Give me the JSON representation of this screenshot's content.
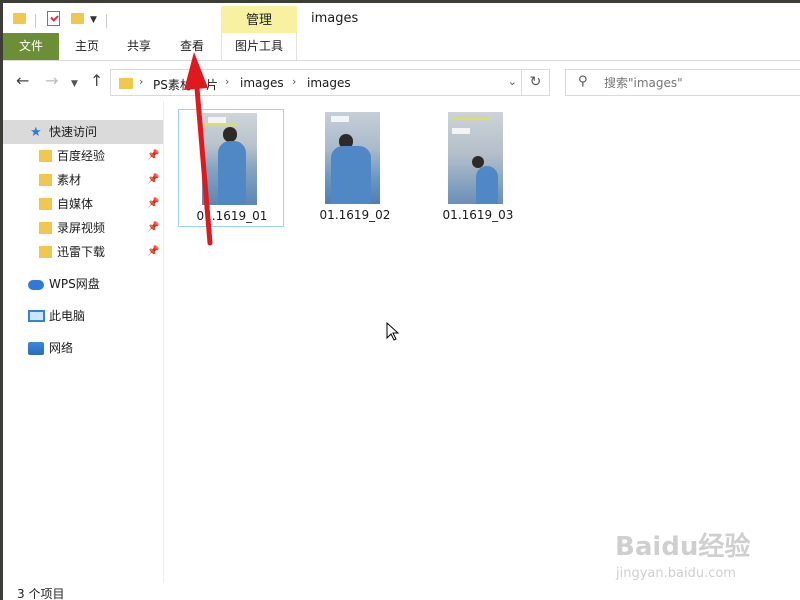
{
  "window": {
    "title": "images"
  },
  "titlebar": {
    "context_tab": "管理"
  },
  "ribbon": {
    "tabs": [
      {
        "label": "文件"
      },
      {
        "label": "主页"
      },
      {
        "label": "共享"
      },
      {
        "label": "查看"
      },
      {
        "label": "图片工具"
      }
    ]
  },
  "address": {
    "breadcrumbs": [
      "PS素材图片",
      "images",
      "images"
    ],
    "breadcrumb_display": [
      "PS素材",
      "片",
      "images",
      "images"
    ]
  },
  "search": {
    "placeholder": "搜索\"images\""
  },
  "nav": {
    "quick_access": "快速访问",
    "pinned": [
      {
        "label": "百度经验"
      },
      {
        "label": "素材"
      },
      {
        "label": "自媒体"
      },
      {
        "label": "录屏视频"
      },
      {
        "label": "迅雷下载"
      }
    ],
    "wps": "WPS网盘",
    "pc": "此电脑",
    "network": "网络"
  },
  "files": [
    {
      "name": "01.1619_01",
      "selected": true
    },
    {
      "name": "01.1619_02",
      "selected": false
    },
    {
      "name": "01.1619_03",
      "selected": false
    }
  ],
  "status": {
    "item_count": "3 个项目"
  },
  "watermark": {
    "logo": "Baidu经验",
    "url": "jingyan.baidu.com"
  },
  "colors": {
    "file_tab": "#6b8e36",
    "context_tab": "#f8f1a1",
    "annotation_arrow": "#e0191f",
    "selection_border": "#99d1ff"
  }
}
